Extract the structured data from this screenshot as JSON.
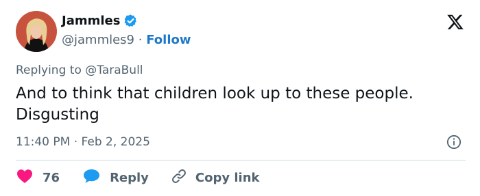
{
  "author": {
    "name": "Jammles",
    "handle": "@jammles9",
    "separator": "·",
    "follow_label": "Follow"
  },
  "replying_to": "Replying to @TaraBull",
  "tweet": {
    "text": "And to think that children look up to these people. Disgusting",
    "timestamp": "11:40 PM · Feb 2, 2025"
  },
  "actions": {
    "like_count": "76",
    "reply_label": "Reply",
    "copy_link_label": "Copy link"
  },
  "icons": {
    "verified": "verified-badge-icon",
    "platform": "x-logo-icon",
    "info": "info-icon",
    "like": "heart-icon",
    "reply": "speech-bubble-icon",
    "copy": "link-icon"
  },
  "colors": {
    "verified": "#1d9bf0",
    "follow": "#1d79c8",
    "heart": "#f91880",
    "reply": "#1d9bf0",
    "text": "#0f1419",
    "muted": "#536471"
  }
}
